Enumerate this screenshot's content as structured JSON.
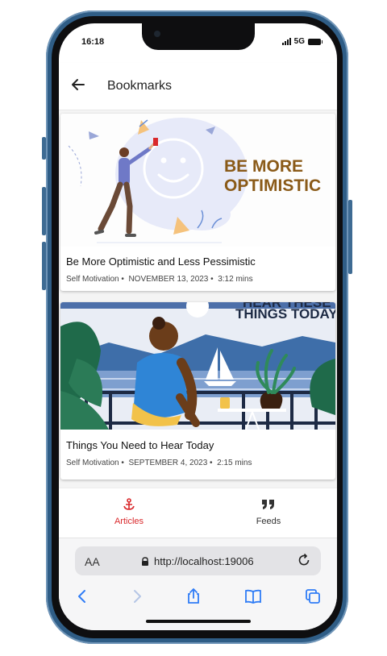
{
  "status": {
    "time": "16:18",
    "network": "5G"
  },
  "header": {
    "title": "Bookmarks"
  },
  "articles": [
    {
      "image_title": "BE MORE\nOPTIMISTIC",
      "title": "Be More Optimistic and Less Pessimistic",
      "category": "Self Motivation",
      "date": "NOVEMBER 13, 2023",
      "read_time": "3:12  mins"
    },
    {
      "image_title": "HEAR THESE\nTHINGS TODAY",
      "title": "Things You Need to Hear Today",
      "category": "Self Motivation",
      "date": "SEPTEMBER 4, 2023",
      "read_time": "2:15  mins"
    }
  ],
  "tabs": [
    {
      "label": "Articles",
      "icon": "anchor-icon",
      "active": true
    },
    {
      "label": "Feeds",
      "icon": "quote-icon",
      "active": false
    }
  ],
  "browser": {
    "text_size": "AA",
    "url": "http://localhost:19006"
  },
  "colors": {
    "accent": "#d9292c",
    "brown_title": "#8a5a18",
    "navy_title": "#1d2a44",
    "safari_blue": "#2f7cf6"
  }
}
